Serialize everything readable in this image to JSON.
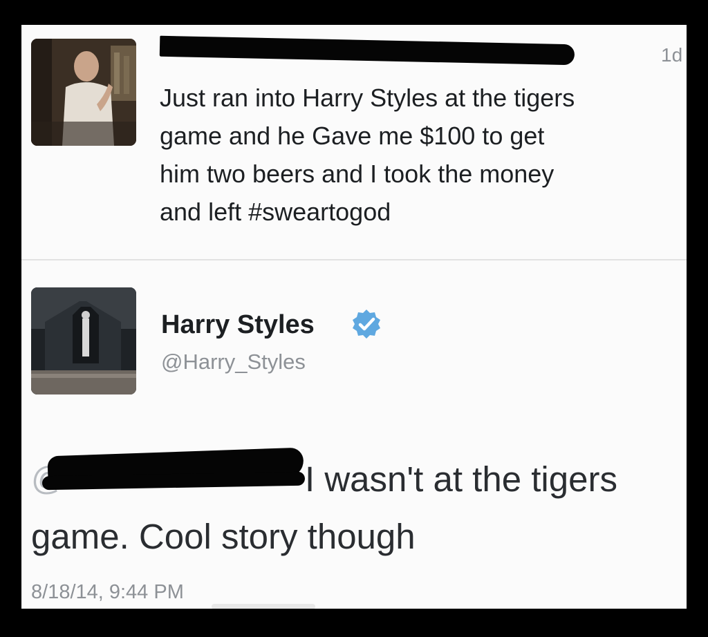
{
  "tweet1": {
    "age": "1d",
    "text": "Just ran into Harry Styles at the tigers\ngame and he Gave me $100 to get\nhim two beers and I took the money\nand left #sweartogod"
  },
  "tweet2": {
    "name": "Harry Styles",
    "handle": "@Harry_Styles",
    "reply_prefix": "@",
    "text": "I wasn't at the tigers game. Cool story though",
    "timestamp": "8/18/14, 9:44 PM",
    "verified_color": "#5fa8e0"
  }
}
